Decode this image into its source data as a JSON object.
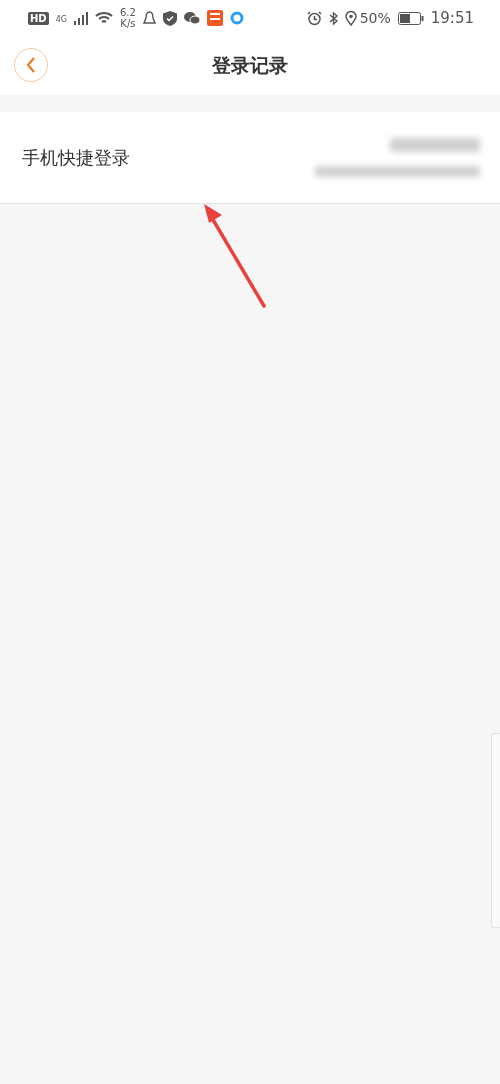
{
  "status_bar": {
    "network_badge": "HD",
    "network_type": "4G",
    "speed_value": "6.2",
    "speed_unit": "K/s",
    "battery": "50%",
    "time": "19:51"
  },
  "header": {
    "title": "登录记录"
  },
  "records": [
    {
      "method": "手机快捷登录"
    }
  ]
}
